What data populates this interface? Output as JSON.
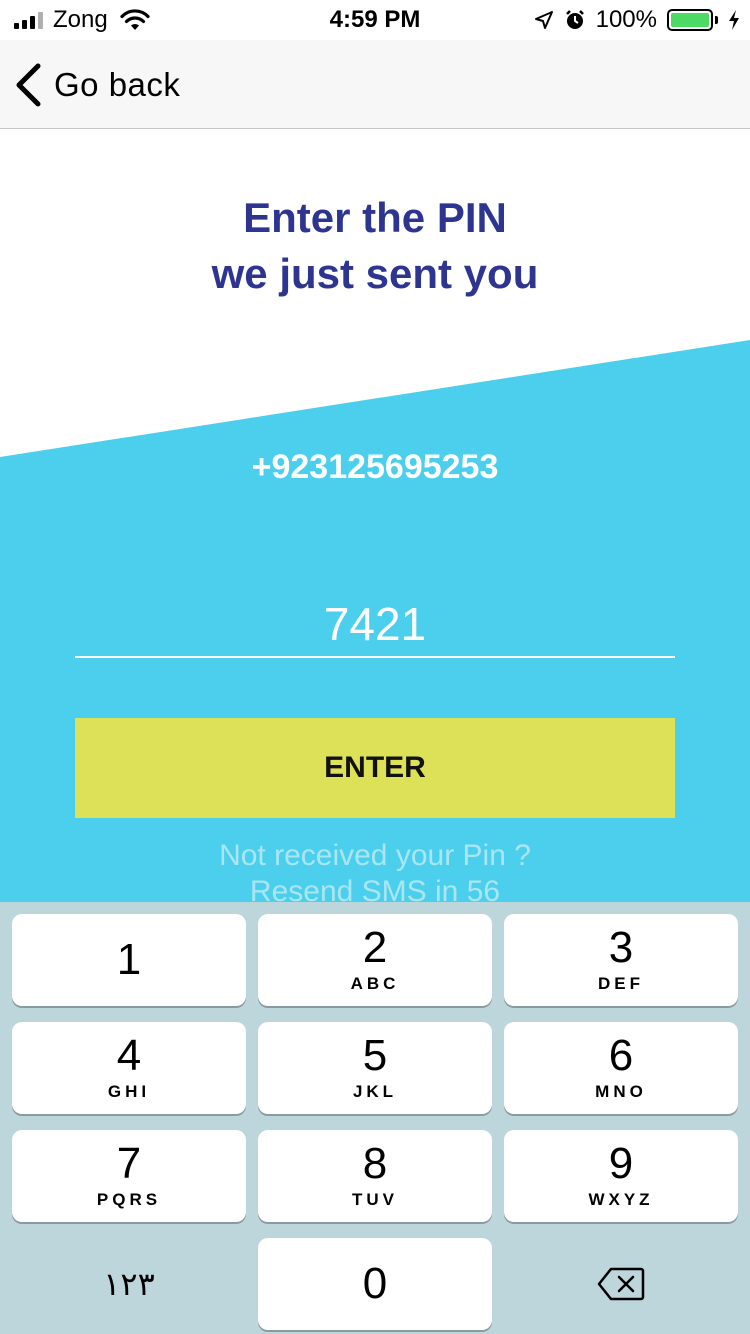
{
  "status_bar": {
    "carrier": "Zong",
    "time": "4:59 PM",
    "battery": "100%"
  },
  "nav": {
    "back_label": "Go back"
  },
  "main": {
    "headline_line1": "Enter the PIN",
    "headline_line2": "we just sent you",
    "phone_number": "+923125695253",
    "pin_value": "7421",
    "enter_label": "ENTER",
    "resend_line1": "Not received your Pin ?",
    "resend_line2": "Resend SMS in 56"
  },
  "colors": {
    "accent_blue": "#4bcfed",
    "heading_navy": "#2d3590",
    "button_yellow": "#dde157",
    "keypad_bg": "#bdd6dc"
  },
  "keypad": {
    "keys": [
      {
        "digit": "1",
        "letters": ""
      },
      {
        "digit": "2",
        "letters": "ABC"
      },
      {
        "digit": "3",
        "letters": "DEF"
      },
      {
        "digit": "4",
        "letters": "GHI"
      },
      {
        "digit": "5",
        "letters": "JKL"
      },
      {
        "digit": "6",
        "letters": "MNO"
      },
      {
        "digit": "7",
        "letters": "PQRS"
      },
      {
        "digit": "8",
        "letters": "TUV"
      },
      {
        "digit": "9",
        "letters": "WXYZ"
      },
      {
        "digit": "0",
        "letters": ""
      }
    ],
    "alt_numerals": "١٢٣",
    "delete_icon": "backspace-icon"
  }
}
